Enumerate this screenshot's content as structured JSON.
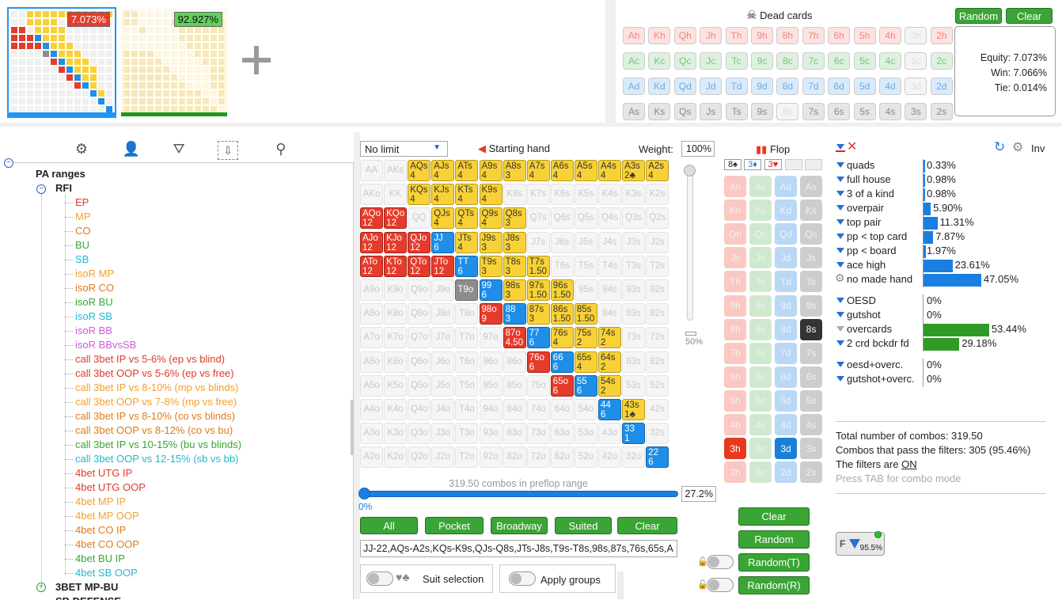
{
  "top": {
    "thumb1_pct": "7.073%",
    "thumb2_pct": "92.927%",
    "dead_cards_title": "Dead cards",
    "random_label": "Random",
    "clear_label": "Clear",
    "dead_rows": [
      [
        "Ah",
        "Kh",
        "Qh",
        "Jh",
        "Th",
        "9h",
        "8h",
        "7h",
        "6h",
        "5h",
        "4h",
        "3h",
        "2h"
      ],
      [
        "Ac",
        "Kc",
        "Qc",
        "Jc",
        "Tc",
        "9c",
        "8c",
        "7c",
        "6c",
        "5c",
        "4c",
        "3c",
        "2c"
      ],
      [
        "Ad",
        "Kd",
        "Qd",
        "Jd",
        "Td",
        "9d",
        "8d",
        "7d",
        "6d",
        "5d",
        "4d",
        "3d",
        "2d"
      ],
      [
        "As",
        "Ks",
        "Qs",
        "Js",
        "Ts",
        "9s",
        "8s",
        "7s",
        "6s",
        "5s",
        "4s",
        "3s",
        "2s"
      ]
    ],
    "equity": "Equity: 7.073%",
    "win": "Win: 7.066%",
    "tie": "Tie: 0.014%"
  },
  "tree": {
    "root": "PA ranges",
    "group": "RFI",
    "items": [
      {
        "label": "EP",
        "color": "#e03a2a"
      },
      {
        "label": "MP",
        "color": "#f0a030"
      },
      {
        "label": "CO",
        "color": "#e07a1a"
      },
      {
        "label": "BU",
        "color": "#3aa535"
      },
      {
        "label": "SB",
        "color": "#20b8d0"
      },
      {
        "label": "isoR MP",
        "color": "#f0a030"
      },
      {
        "label": "isoR CO",
        "color": "#e07a1a"
      },
      {
        "label": "isoR BU",
        "color": "#3aa535"
      },
      {
        "label": "isoR SB",
        "color": "#20b8d0"
      },
      {
        "label": "isoR BB",
        "color": "#d45ad4"
      },
      {
        "label": "isoR BBvsSB",
        "color": "#d45ad4"
      },
      {
        "label": "call 3bet IP vs 5-6% (ep vs blind)",
        "color": "#e03a2a"
      },
      {
        "label": "call 3bet OOP vs 5-6% (ep vs free)",
        "color": "#e03a2a"
      },
      {
        "label": "call 3bet IP vs 8-10% (mp vs blinds)",
        "color": "#f0a030"
      },
      {
        "label": "call 3bet OOP vs 7-8% (mp vs free)",
        "color": "#f0a030"
      },
      {
        "label": "call 3bet IP vs 8-10% (co vs blinds)",
        "color": "#e07a1a"
      },
      {
        "label": "call 3bet OOP vs 8-12% (co vs bu)",
        "color": "#e07a1a"
      },
      {
        "label": "call 3bet IP vs 10-15% (bu vs blinds)",
        "color": "#3aa535"
      },
      {
        "label": "call 3bet OOP vs 12-15% (sb vs bb)",
        "color": "#20b8d0"
      },
      {
        "label": "4bet UTG IP",
        "color": "#e03a2a"
      },
      {
        "label": "4bet UTG OOP",
        "color": "#e03a2a"
      },
      {
        "label": "4bet MP IP",
        "color": "#f0a030"
      },
      {
        "label": "4bet MP OOP",
        "color": "#f0a030"
      },
      {
        "label": "4bet CO IP",
        "color": "#e07a1a"
      },
      {
        "label": "4bet CO OOP",
        "color": "#e07a1a"
      },
      {
        "label": "4bet BU IP",
        "color": "#3aa535"
      },
      {
        "label": "4bet SB OOP",
        "color": "#20b8d0"
      }
    ],
    "group2": "3BET MP-BU",
    "group3": "SB DEFENSE"
  },
  "matrix": {
    "limit": "No limit",
    "starting_hand": "Starting hand",
    "weight_label": "Weight:",
    "weight_value": "100%",
    "slider_pct": "50%",
    "combos_text": "319.50 combos in preflop range",
    "range_pct": "27.2%",
    "zero_pct": "0%",
    "buttons": [
      "All",
      "Pocket",
      "Broadway",
      "Suited",
      "Clear"
    ],
    "range_string": "JJ-22,AQs-A2s,KQs-K9s,QJs-Q8s,JTs-J8s,T9s-T8s,98s,87s,76s,65s,A",
    "suit_selection": "Suit selection",
    "apply_groups": "Apply groups",
    "rows": [
      [
        [
          "AA",
          "off"
        ],
        [
          "AKs",
          "off"
        ],
        [
          "AQs\n4",
          "y"
        ],
        [
          "AJs\n4",
          "y"
        ],
        [
          "ATs\n4",
          "y"
        ],
        [
          "A9s\n4",
          "y"
        ],
        [
          "A8s\n3",
          "y"
        ],
        [
          "A7s\n4",
          "y"
        ],
        [
          "A6s\n4",
          "y"
        ],
        [
          "A5s\n4",
          "y"
        ],
        [
          "A4s\n4",
          "y"
        ],
        [
          "A3s\n2♣",
          "y"
        ],
        [
          "A2s\n4",
          "y"
        ]
      ],
      [
        [
          "AKo",
          "off"
        ],
        [
          "KK",
          "off"
        ],
        [
          "KQs\n4",
          "y"
        ],
        [
          "KJs\n4",
          "y"
        ],
        [
          "KTs\n4",
          "y"
        ],
        [
          "K9s\n4",
          "y"
        ],
        [
          "K8s",
          "off"
        ],
        [
          "K7s",
          "off"
        ],
        [
          "K6s",
          "off"
        ],
        [
          "K5s",
          "off"
        ],
        [
          "K4s",
          "off"
        ],
        [
          "K3s",
          "off"
        ],
        [
          "K2s",
          "off"
        ]
      ],
      [
        [
          "AQo\n12",
          "r"
        ],
        [
          "KQo\n12",
          "r"
        ],
        [
          "QQ",
          "off"
        ],
        [
          "QJs\n4",
          "y"
        ],
        [
          "QTs\n4",
          "y"
        ],
        [
          "Q9s\n4",
          "y"
        ],
        [
          "Q8s\n3",
          "y"
        ],
        [
          "Q7s",
          "off"
        ],
        [
          "Q6s",
          "off"
        ],
        [
          "Q5s",
          "off"
        ],
        [
          "Q4s",
          "off"
        ],
        [
          "Q3s",
          "off"
        ],
        [
          "Q2s",
          "off"
        ]
      ],
      [
        [
          "AJo\n12",
          "r"
        ],
        [
          "KJo\n12",
          "r"
        ],
        [
          "QJo\n12",
          "r"
        ],
        [
          "JJ\n6",
          "b"
        ],
        [
          "JTs\n4",
          "y"
        ],
        [
          "J9s\n3",
          "y"
        ],
        [
          "J8s\n3",
          "y"
        ],
        [
          "J7s",
          "off"
        ],
        [
          "J6s",
          "off"
        ],
        [
          "J5s",
          "off"
        ],
        [
          "J4s",
          "off"
        ],
        [
          "J3s",
          "off"
        ],
        [
          "J2s",
          "off"
        ]
      ],
      [
        [
          "ATo\n12",
          "r"
        ],
        [
          "KTo\n12",
          "r"
        ],
        [
          "QTo\n12",
          "r"
        ],
        [
          "JTo\n12",
          "r"
        ],
        [
          "TT\n6",
          "b"
        ],
        [
          "T9s\n3",
          "y"
        ],
        [
          "T8s\n3",
          "y"
        ],
        [
          "T7s\n1.50",
          "y"
        ],
        [
          "T6s",
          "off"
        ],
        [
          "T5s",
          "off"
        ],
        [
          "T4s",
          "off"
        ],
        [
          "T3s",
          "off"
        ],
        [
          "T2s",
          "off"
        ]
      ],
      [
        [
          "A9o",
          "off"
        ],
        [
          "K9o",
          "off"
        ],
        [
          "Q9o",
          "off"
        ],
        [
          "J9o",
          "off"
        ],
        [
          "T9o",
          "g"
        ],
        [
          "99\n6",
          "b"
        ],
        [
          "98s\n3",
          "y"
        ],
        [
          "97s\n1.50",
          "y"
        ],
        [
          "96s\n1.50",
          "y"
        ],
        [
          "95s",
          "off"
        ],
        [
          "94s",
          "off"
        ],
        [
          "93s",
          "off"
        ],
        [
          "92s",
          "off"
        ]
      ],
      [
        [
          "A8o",
          "off"
        ],
        [
          "K8o",
          "off"
        ],
        [
          "Q8o",
          "off"
        ],
        [
          "J8o",
          "off"
        ],
        [
          "T8o",
          "off"
        ],
        [
          "98o\n9",
          "r"
        ],
        [
          "88\n3",
          "b"
        ],
        [
          "87s\n3",
          "y"
        ],
        [
          "86s\n1.50",
          "y"
        ],
        [
          "85s\n1.50",
          "y"
        ],
        [
          "84s",
          "off"
        ],
        [
          "83s",
          "off"
        ],
        [
          "82s",
          "off"
        ]
      ],
      [
        [
          "A7o",
          "off"
        ],
        [
          "K7o",
          "off"
        ],
        [
          "Q7o",
          "off"
        ],
        [
          "J7o",
          "off"
        ],
        [
          "T7o",
          "off"
        ],
        [
          "97o",
          "off"
        ],
        [
          "87o\n4.50",
          "r"
        ],
        [
          "77\n6",
          "b"
        ],
        [
          "76s\n4",
          "y"
        ],
        [
          "75s\n2",
          "y"
        ],
        [
          "74s\n2",
          "y"
        ],
        [
          "73s",
          "off"
        ],
        [
          "72s",
          "off"
        ]
      ],
      [
        [
          "A6o",
          "off"
        ],
        [
          "K6o",
          "off"
        ],
        [
          "Q6o",
          "off"
        ],
        [
          "J6o",
          "off"
        ],
        [
          "T6o",
          "off"
        ],
        [
          "96o",
          "off"
        ],
        [
          "86o",
          "off"
        ],
        [
          "76o\n6",
          "r"
        ],
        [
          "66\n6",
          "b"
        ],
        [
          "65s\n4",
          "y"
        ],
        [
          "64s\n2",
          "y"
        ],
        [
          "63s",
          "off"
        ],
        [
          "62s",
          "off"
        ]
      ],
      [
        [
          "A5o",
          "off"
        ],
        [
          "K5o",
          "off"
        ],
        [
          "Q5o",
          "off"
        ],
        [
          "J5o",
          "off"
        ],
        [
          "T5o",
          "off"
        ],
        [
          "95o",
          "off"
        ],
        [
          "85o",
          "off"
        ],
        [
          "75o",
          "off"
        ],
        [
          "65o\n6",
          "r"
        ],
        [
          "55\n6",
          "b"
        ],
        [
          "54s\n2",
          "y"
        ],
        [
          "53s",
          "off"
        ],
        [
          "52s",
          "off"
        ]
      ],
      [
        [
          "A4o",
          "off"
        ],
        [
          "K4o",
          "off"
        ],
        [
          "Q4o",
          "off"
        ],
        [
          "J4o",
          "off"
        ],
        [
          "T4o",
          "off"
        ],
        [
          "94o",
          "off"
        ],
        [
          "84o",
          "off"
        ],
        [
          "74o",
          "off"
        ],
        [
          "64o",
          "off"
        ],
        [
          "54o",
          "off"
        ],
        [
          "44\n6",
          "b"
        ],
        [
          "43s\n1♣",
          "y"
        ],
        [
          "42s",
          "off"
        ]
      ],
      [
        [
          "A3o",
          "off"
        ],
        [
          "K3o",
          "off"
        ],
        [
          "Q3o",
          "off"
        ],
        [
          "J3o",
          "off"
        ],
        [
          "T3o",
          "off"
        ],
        [
          "93o",
          "off"
        ],
        [
          "83o",
          "off"
        ],
        [
          "73o",
          "off"
        ],
        [
          "63o",
          "off"
        ],
        [
          "53o",
          "off"
        ],
        [
          "43o",
          "off"
        ],
        [
          "33\n1",
          "b"
        ],
        [
          "32s",
          "off"
        ]
      ],
      [
        [
          "A2o",
          "off"
        ],
        [
          "K2o",
          "off"
        ],
        [
          "Q2o",
          "off"
        ],
        [
          "J2o",
          "off"
        ],
        [
          "T2o",
          "off"
        ],
        [
          "92o",
          "off"
        ],
        [
          "82o",
          "off"
        ],
        [
          "72o",
          "off"
        ],
        [
          "62o",
          "off"
        ],
        [
          "52o",
          "off"
        ],
        [
          "42o",
          "off"
        ],
        [
          "32o",
          "off"
        ],
        [
          "22\n6",
          "b"
        ]
      ]
    ]
  },
  "flop": {
    "title": "Flop",
    "slot1": "8♠",
    "slot2": "3♦",
    "slot3": "3♥",
    "ranks": [
      "A",
      "K",
      "Q",
      "J",
      "T",
      "9",
      "8",
      "7",
      "6",
      "5",
      "4",
      "3",
      "2"
    ],
    "clear": "Clear",
    "random": "Random",
    "random_t": "Random(T)",
    "random_r": "Random(R)"
  },
  "stats": {
    "inv": "Inv",
    "made": [
      {
        "label": "quads",
        "value": "0.33%",
        "bar": 0.33,
        "color": "blue"
      },
      {
        "label": "full house",
        "value": "0.98%",
        "bar": 0.98,
        "color": "blue"
      },
      {
        "label": "3 of a kind",
        "value": "0.98%",
        "bar": 0.98,
        "color": "blue"
      },
      {
        "label": "overpair",
        "value": "5.90%",
        "bar": 5.9,
        "color": "blue"
      },
      {
        "label": "top pair",
        "value": "11.31%",
        "bar": 11.31,
        "color": "blue"
      },
      {
        "label": "pp < top card",
        "value": "7.87%",
        "bar": 7.87,
        "color": "blue"
      },
      {
        "label": "pp < board",
        "value": "1.97%",
        "bar": 1.97,
        "color": "blue"
      },
      {
        "label": "ace high",
        "value": "23.61%",
        "bar": 23.61,
        "color": "blue"
      },
      {
        "label": "no made hand",
        "value": "47.05%",
        "bar": 47.05,
        "color": "blue"
      }
    ],
    "draws": [
      {
        "label": "OESD",
        "value": "0%",
        "bar": 0,
        "color": "green"
      },
      {
        "label": "gutshot",
        "value": "0%",
        "bar": 0,
        "color": "green"
      },
      {
        "label": "overcards",
        "value": "53.44%",
        "bar": 53.44,
        "color": "green"
      },
      {
        "label": "2 crd bckdr fd",
        "value": "29.18%",
        "bar": 29.18,
        "color": "green"
      }
    ],
    "combo_draws": [
      {
        "label": "oesd+overc.",
        "value": "0%"
      },
      {
        "label": "gutshot+overc.",
        "value": "0%"
      }
    ],
    "total": "Total number of combos: 319.50",
    "pass": "Combos that pass the filters: 305 (95.46%)",
    "filters_pre": "The filters are ",
    "filters_on": "ON",
    "tab_hint": "Press TAB for combo mode",
    "badge": "95.5%"
  }
}
